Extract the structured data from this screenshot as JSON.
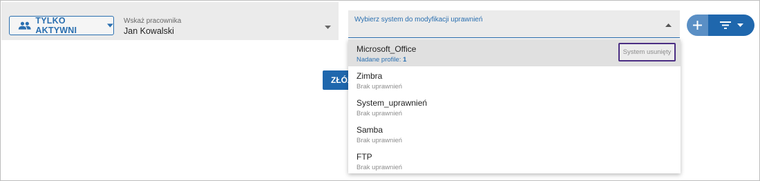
{
  "filter_active": {
    "label": "TYLKO AKTYWNI",
    "icon": "people-icon"
  },
  "employee": {
    "label": "Wskaż pracownika",
    "value": "Jan Kowalski"
  },
  "system_select": {
    "label": "Wybierz system do modyfikacji uprawnień"
  },
  "actions": {
    "add_icon": "plus-icon",
    "filter_icon": "filter-list-icon"
  },
  "submit": {
    "label": "ZŁÓŻ"
  },
  "options": [
    {
      "name": "Microsoft_Office",
      "sub_prefix": "Nadane profile: ",
      "sub_count": "1",
      "badge": "System usunięty"
    },
    {
      "name": "Zimbra",
      "sub": "Brak uprawnień"
    },
    {
      "name": "System_uprawnień",
      "sub": "Brak uprawnień"
    },
    {
      "name": "Samba",
      "sub": "Brak uprawnień"
    },
    {
      "name": "FTP",
      "sub": "Brak uprawnień"
    }
  ],
  "colors": {
    "accent": "#2a6fb0",
    "primary_dark": "#1f67ad",
    "primary_light": "#5a8fc5",
    "badge_border": "#4b2e83"
  }
}
